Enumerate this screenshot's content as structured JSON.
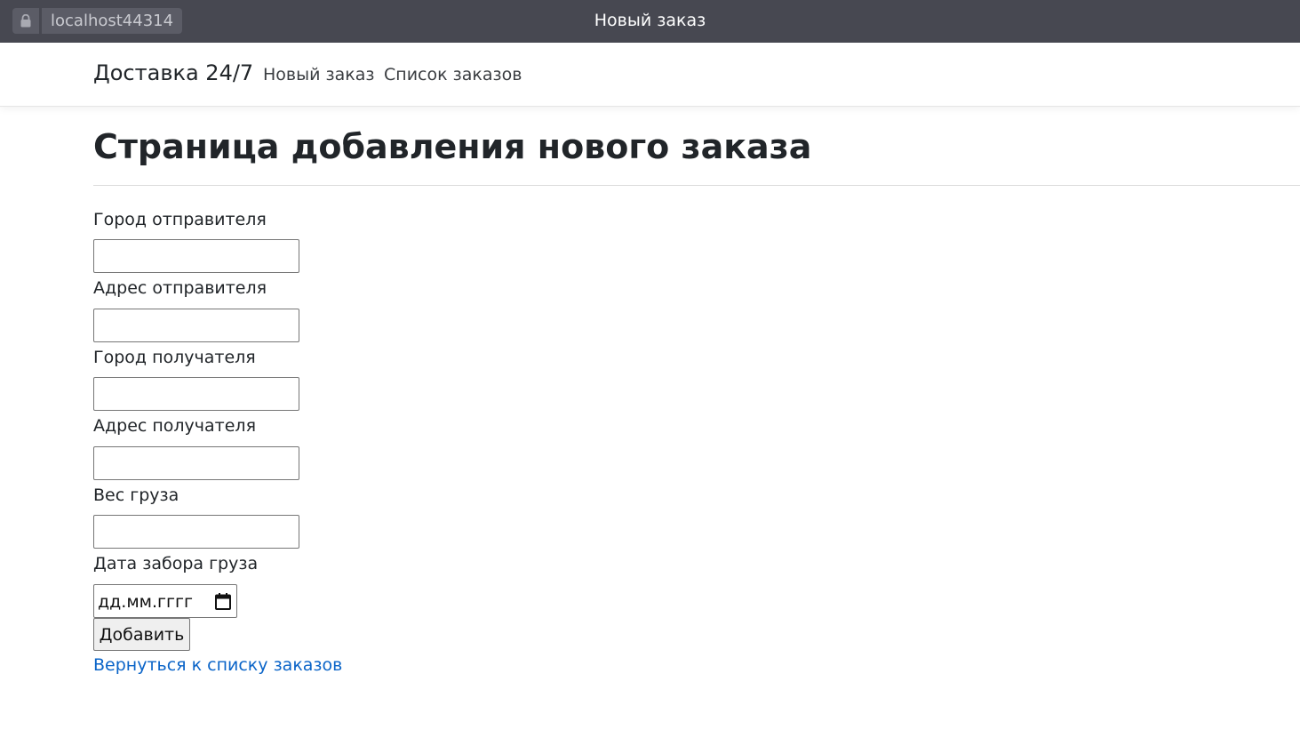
{
  "browser": {
    "url": "localhost44314",
    "window_title": "Новый заказ"
  },
  "navbar": {
    "brand": "Доставка 24/7",
    "links": [
      "Новый заказ",
      "Список заказов"
    ]
  },
  "page": {
    "title": "Страница добавления нового заказа"
  },
  "form": {
    "fields": [
      {
        "label": "Город отправителя",
        "value": ""
      },
      {
        "label": "Адрес отправителя",
        "value": ""
      },
      {
        "label": "Город получателя",
        "value": ""
      },
      {
        "label": "Адрес получателя",
        "value": ""
      },
      {
        "label": "Вес груза",
        "value": ""
      },
      {
        "label": "Дата забора груза",
        "value": "дд.мм.гггг"
      }
    ],
    "submit_label": "Добавить",
    "back_link": "Вернуться к списку заказов"
  },
  "colors": {
    "titlebar": "#474851",
    "link": "#0a64c8"
  }
}
